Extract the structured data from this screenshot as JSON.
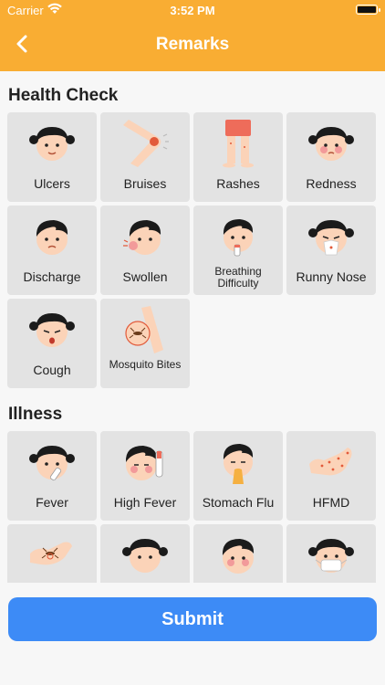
{
  "status": {
    "carrier": "Carrier",
    "time": "3:52 PM"
  },
  "header": {
    "title": "Remarks"
  },
  "health_check": {
    "title": "Health Check",
    "items": [
      {
        "label": "Ulcers",
        "icon": "girl-face-icon"
      },
      {
        "label": "Bruises",
        "icon": "bruised-arm-icon"
      },
      {
        "label": "Rashes",
        "icon": "legs-rash-icon"
      },
      {
        "label": "Redness",
        "icon": "girl-face-redness-icon"
      },
      {
        "label": "Discharge",
        "icon": "boy-face-discharge-icon"
      },
      {
        "label": "Swollen",
        "icon": "boy-face-swollen-icon"
      },
      {
        "label": "Breathing Difficulty",
        "icon": "boy-face-breathing-icon"
      },
      {
        "label": "Runny Nose",
        "icon": "girl-face-tissue-icon"
      },
      {
        "label": "Cough",
        "icon": "girl-face-cough-icon"
      },
      {
        "label": "Mosquito Bites",
        "icon": "mosquito-arm-icon"
      }
    ]
  },
  "illness": {
    "title": "Illness",
    "items": [
      {
        "label": "Fever",
        "icon": "girl-face-thermometer-icon"
      },
      {
        "label": "High Fever",
        "icon": "boy-face-high-fever-icon"
      },
      {
        "label": "Stomach Flu",
        "icon": "boy-face-vomit-icon"
      },
      {
        "label": "HFMD",
        "icon": "hand-spots-icon"
      },
      {
        "label": "",
        "icon": "mosquito-hand-icon"
      },
      {
        "label": "",
        "icon": "girl-face-icon"
      },
      {
        "label": "",
        "icon": "boy-face-icon"
      },
      {
        "label": "",
        "icon": "girl-face-mask-icon"
      }
    ]
  },
  "footer": {
    "submit_label": "Submit"
  },
  "colors": {
    "header": "#f9ad33",
    "submit": "#3d8bf6",
    "card": "#e3e3e3"
  }
}
